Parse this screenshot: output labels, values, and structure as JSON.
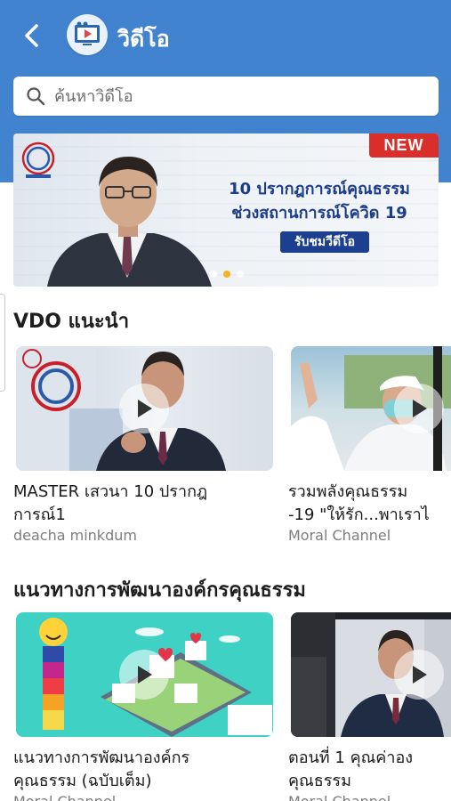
{
  "header": {
    "title": "วิดีโอ",
    "background_color": "#4183cf",
    "back_icon": "chevron-left-icon",
    "app_icon": "video-player-icon"
  },
  "search": {
    "placeholder": "ค้นหาวิดีโอ",
    "icon": "search-icon"
  },
  "banner": {
    "badge": "NEW",
    "headline_line1": "10 ปรากฎการณ์คุณธรรม",
    "headline_line2": "ช่วงสถานการณ์โควิด 19",
    "cta": "รับชมวีดีโอ",
    "slides": 3,
    "active_slide": 1
  },
  "sections": [
    {
      "title": "VDO แนะนำ",
      "cards": [
        {
          "title": "MASTER เสวนา 10 ปรากฎ\nการณ์1",
          "channel": "deacha minkdum"
        },
        {
          "title": "รวมพลังคุณธรรม\n-19 \"ให้รัก...พาเราไ",
          "channel": "Moral Channel"
        }
      ]
    },
    {
      "title": "แนวทางการพัฒนาองค์กรคุณธรรม",
      "cards": [
        {
          "title": "แนวทางการพัฒนาองค์กร\nคุณธรรม (ฉบับเต็ม)",
          "channel": "Moral Channel"
        },
        {
          "title": "ตอนที่ 1 คุณค่าอง\nคุณธรรม",
          "channel": "Moral Channel"
        }
      ]
    }
  ],
  "colors": {
    "accent": "#4183cf",
    "badge": "#d92e2a",
    "cta": "#1d3f8f",
    "active_dot": "#f3b323"
  }
}
